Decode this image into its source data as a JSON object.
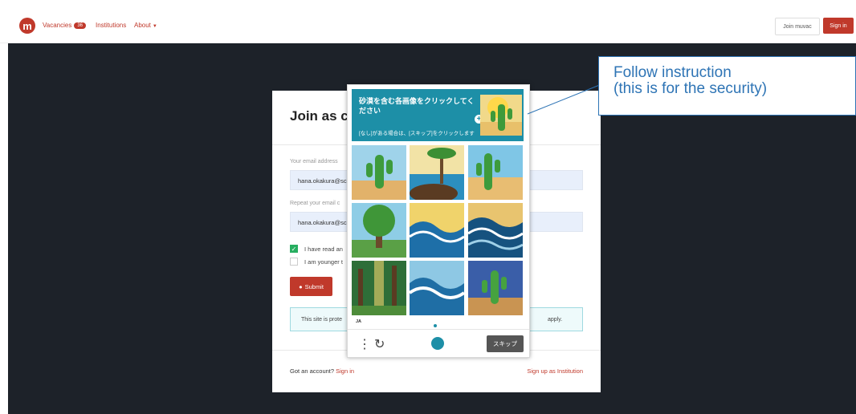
{
  "nav": {
    "logo_letter": "m",
    "vacancies_label": "Vacancies",
    "vacancies_count": "36",
    "institutions_label": "Institutions",
    "about_label": "About",
    "join_label": "Join muvac",
    "signin_label": "Sign in"
  },
  "form": {
    "title": "Join as c",
    "email_label": "Your email address",
    "email_value": "hana.okakura@sc",
    "repeat_label": "Repeat your email c",
    "repeat_value": "hana.okakura@sc",
    "check1_label": "I have read an",
    "check1_checked": true,
    "check2_label": "I am younger t",
    "check2_checked": false,
    "submit_label": "Submit",
    "notice_left": "This site is prote",
    "notice_right": "apply.",
    "footer_left": "Got an account?",
    "footer_signin": "Sign in",
    "footer_right": "Sign up as Institution"
  },
  "captcha": {
    "title": "砂漠を含む各画像をクリックしてください",
    "subtitle": "[なし]がある場合は、[スキップ]をクリックします",
    "tiles": [
      {
        "name": "cactus"
      },
      {
        "name": "beach"
      },
      {
        "name": "cactus"
      },
      {
        "name": "forest"
      },
      {
        "name": "waves"
      },
      {
        "name": "waves"
      },
      {
        "name": "forest"
      },
      {
        "name": "waves"
      },
      {
        "name": "cactus"
      }
    ],
    "lang": "JA",
    "menu_icon": "⋮",
    "refresh_icon": "↻",
    "skip_label": "スキップ"
  },
  "annotation": {
    "line1": "Follow instruction",
    "line2": "(this is for the security)"
  },
  "colors": {
    "brand_red": "#c0392b",
    "captcha_teal": "#1d8fa7",
    "annotation_blue": "#2e74b5"
  }
}
